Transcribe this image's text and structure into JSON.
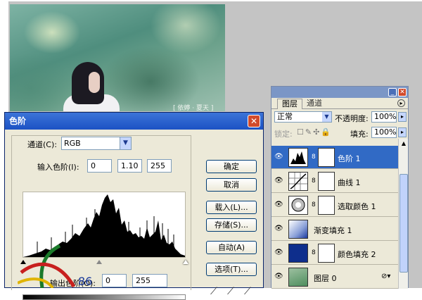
{
  "photo": {
    "signature": "[ 依婷 · 夏天 ]"
  },
  "levels_dialog": {
    "title": "色阶",
    "channel_label": "通道(C):",
    "channel_value": "RGB",
    "input_label": "输入色阶(I):",
    "input_values": [
      "0",
      "1.10",
      "255"
    ],
    "output_label": "输出色阶(O):",
    "output_values": [
      "0",
      "255"
    ],
    "buttons": [
      "确定",
      "取消",
      "载入(L)...",
      "存储(S)...",
      "自动(A)",
      "选项(T)..."
    ],
    "logo_text": "86"
  },
  "layers_panel": {
    "tabs": [
      "图层",
      "通道"
    ],
    "blend_mode": "正常",
    "opacity_label": "不透明度:",
    "opacity_value": "100%",
    "lock_label": "锁定:",
    "fill_label": "填充:",
    "fill_value": "100%",
    "layers": [
      {
        "name": "色阶 1",
        "selected": true
      },
      {
        "name": "曲线 1",
        "selected": false
      },
      {
        "name": "选取颜色 1",
        "selected": false
      },
      {
        "name": "渐变填充 1",
        "selected": false
      },
      {
        "name": "颜色填充 2",
        "selected": false
      },
      {
        "name": "图层 0",
        "selected": false
      }
    ]
  },
  "colors": {
    "titlebar": "#2a5fd0",
    "selection": "#316ac5",
    "dialog_bg": "#ece9d8"
  }
}
